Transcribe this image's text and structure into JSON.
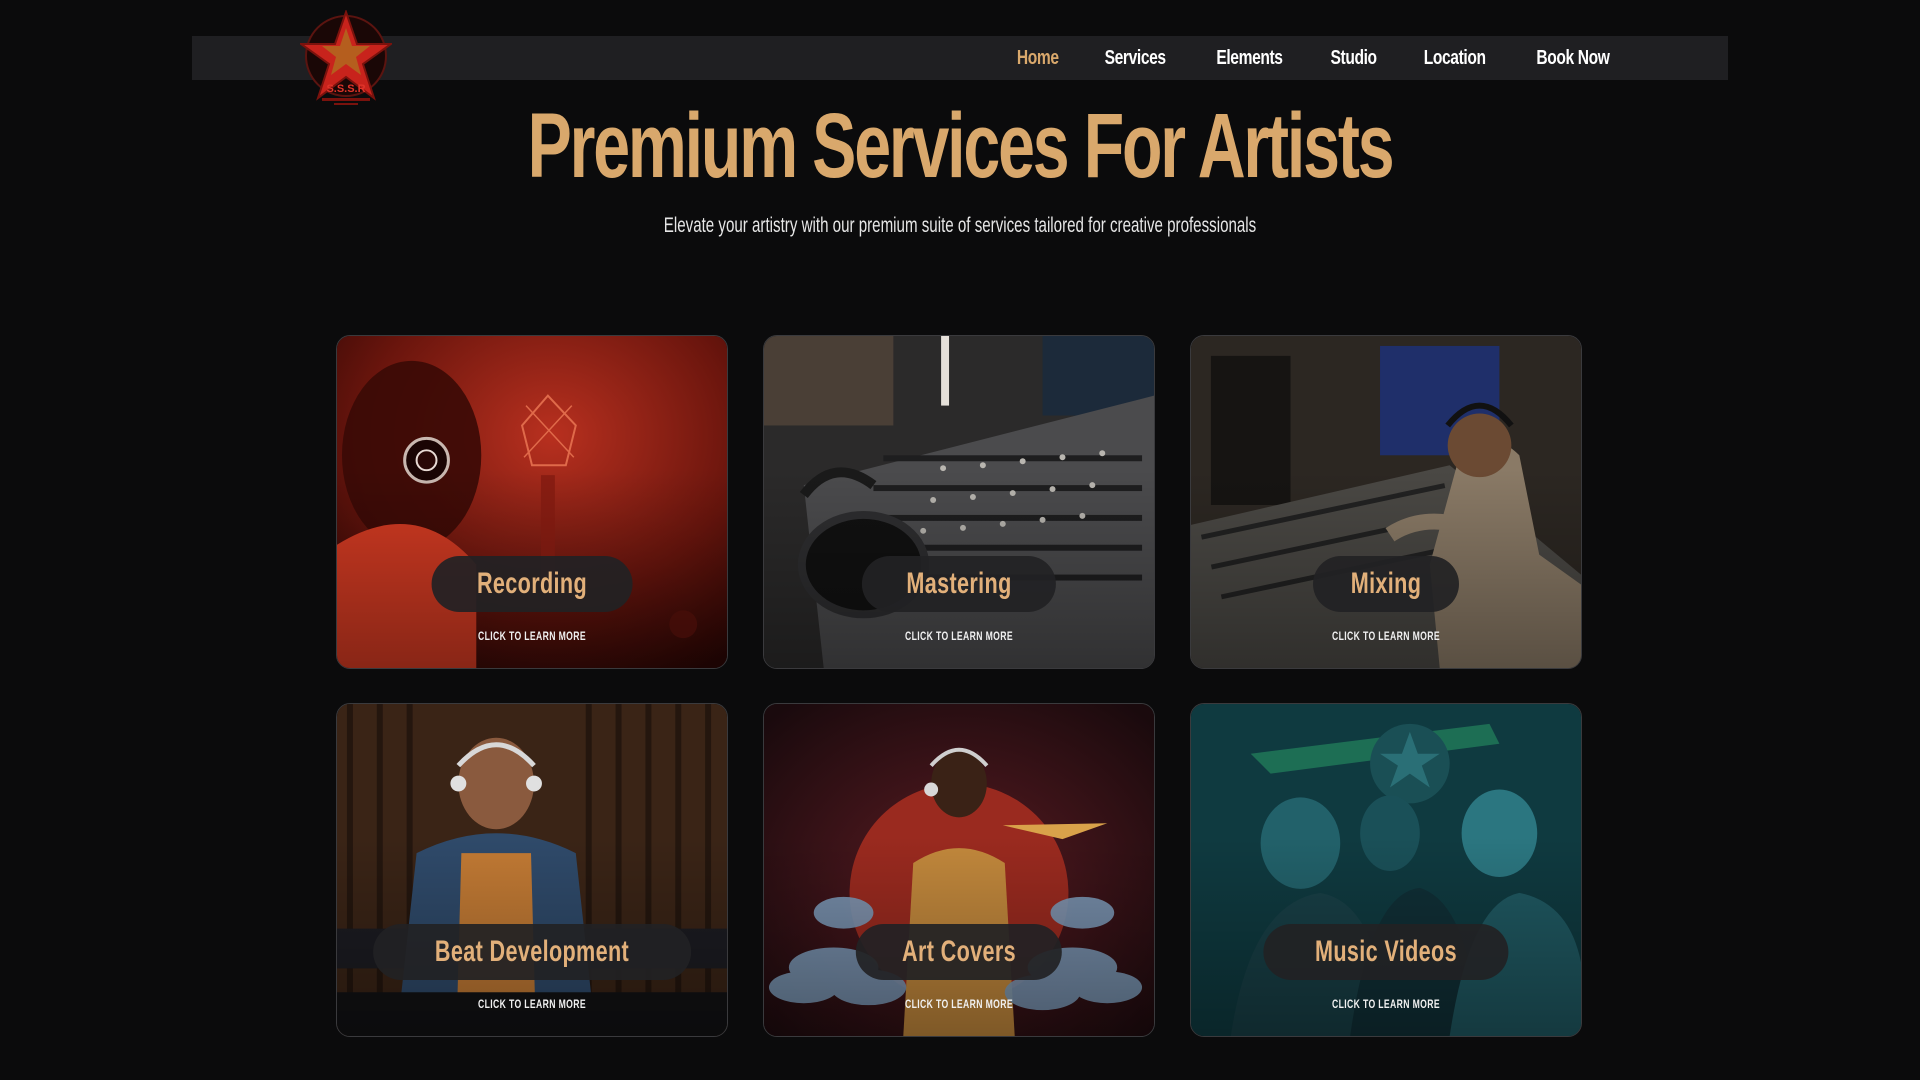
{
  "brand": {
    "logo_text": "S.S.S.R",
    "accent_color": "#d9a86c",
    "logo_color": "#c8231c"
  },
  "nav": {
    "items": [
      {
        "label": "Home",
        "active": true
      },
      {
        "label": "Services",
        "active": false
      },
      {
        "label": "Elements",
        "active": false
      },
      {
        "label": "Studio",
        "active": false
      },
      {
        "label": "Location",
        "active": false
      },
      {
        "label": "Book Now",
        "active": false
      }
    ]
  },
  "hero": {
    "title": "Premium Services For Artists",
    "subtitle": "Elevate your artistry with our premium suite of services tailored for creative professionals"
  },
  "services": [
    {
      "title": "Recording",
      "cta": "CLICK TO LEARN MORE"
    },
    {
      "title": "Mastering",
      "cta": "CLICK TO LEARN MORE"
    },
    {
      "title": "Mixing",
      "cta": "CLICK TO LEARN MORE"
    },
    {
      "title": "Beat Development",
      "cta": "CLICK TO LEARN MORE"
    },
    {
      "title": "Art Covers",
      "cta": "CLICK TO LEARN MORE"
    },
    {
      "title": "Music Videos",
      "cta": "CLICK TO LEARN MORE"
    }
  ]
}
